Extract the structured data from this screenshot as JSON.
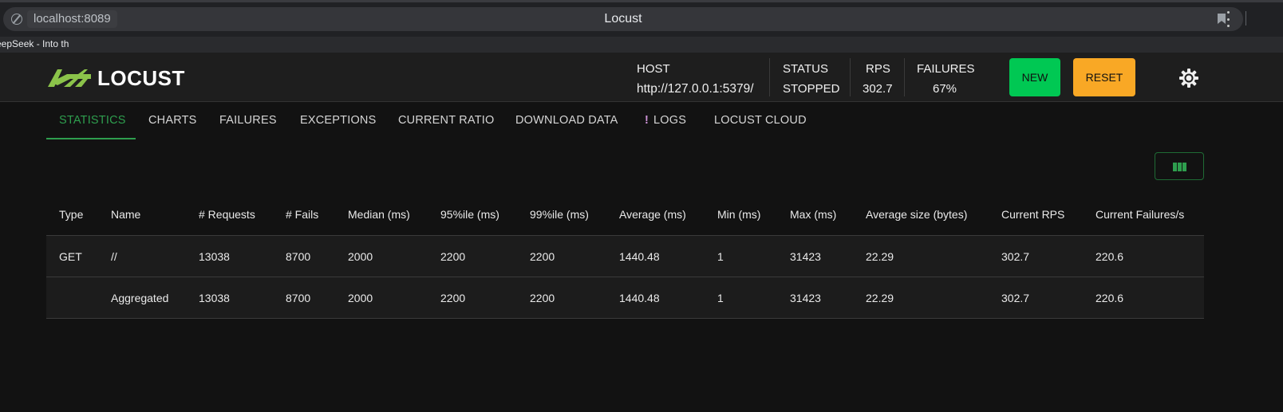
{
  "browser": {
    "url": "localhost:8089",
    "page_title": "Locust",
    "bookmark_label": "eepSeek - Into th"
  },
  "app": {
    "logo_text": "LOCUST",
    "host_label": "HOST",
    "host_value": "http://127.0.0.1:5379/",
    "status_label": "STATUS",
    "status_value": "STOPPED",
    "rps_label": "RPS",
    "rps_value": "302.7",
    "failures_label": "FAILURES",
    "failures_value": "67%",
    "new_label": "NEW",
    "reset_label": "RESET",
    "accent_color": "#2e9e4e",
    "new_color": "#00c853",
    "reset_color": "#f9a825"
  },
  "tabs": [
    {
      "label": "STATISTICS",
      "active": true
    },
    {
      "label": "CHARTS"
    },
    {
      "label": "FAILURES"
    },
    {
      "label": "EXCEPTIONS"
    },
    {
      "label": "CURRENT RATIO"
    },
    {
      "label": "DOWNLOAD DATA"
    },
    {
      "label": "LOGS",
      "icon": "exclamation-icon"
    },
    {
      "label": "LOCUST CLOUD"
    }
  ],
  "table": {
    "columns": [
      "Type",
      "Name",
      "# Requests",
      "# Fails",
      "Median (ms)",
      "95%ile (ms)",
      "99%ile (ms)",
      "Average (ms)",
      "Min (ms)",
      "Max (ms)",
      "Average size (bytes)",
      "Current RPS",
      "Current Failures/s"
    ],
    "rows": [
      [
        "GET",
        "//",
        "13038",
        "8700",
        "2000",
        "2200",
        "2200",
        "1440.48",
        "1",
        "31423",
        "22.29",
        "302.7",
        "220.6"
      ],
      [
        "",
        "Aggregated",
        "13038",
        "8700",
        "2000",
        "2200",
        "2200",
        "1440.48",
        "1",
        "31423",
        "22.29",
        "302.7",
        "220.6"
      ]
    ]
  }
}
